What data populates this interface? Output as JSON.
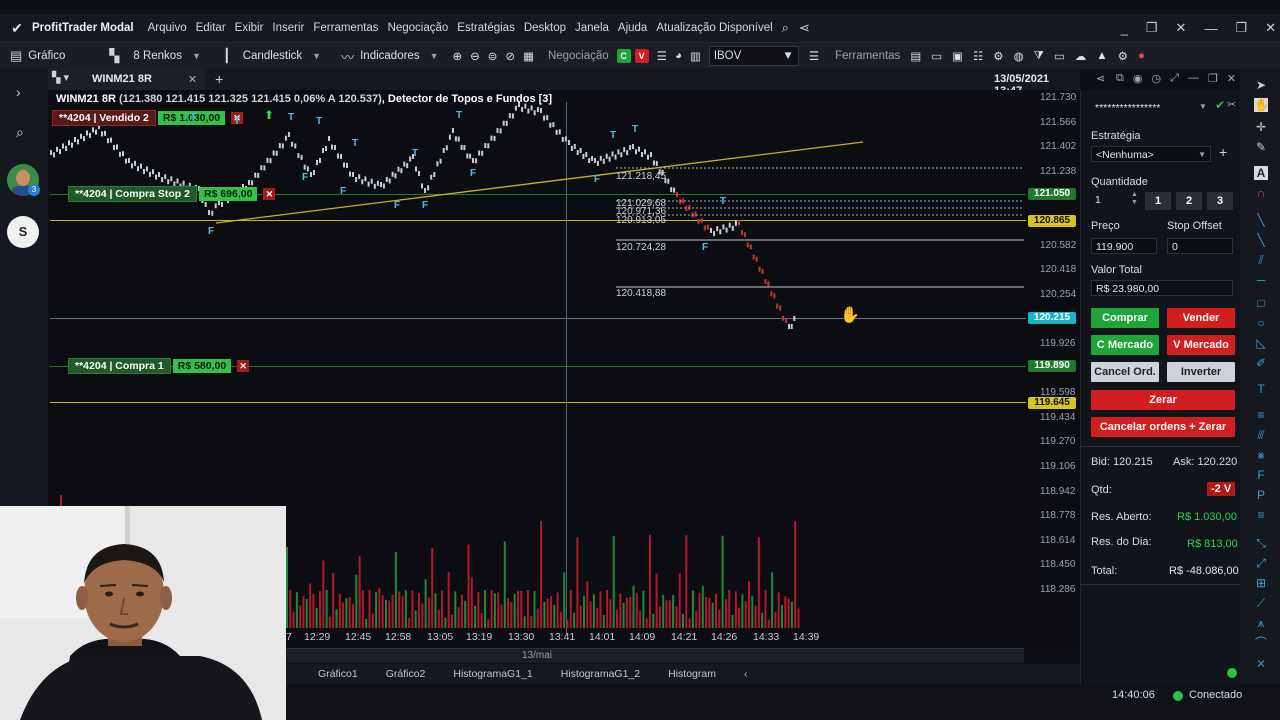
{
  "app": {
    "title": "ProfitTrader Modal",
    "menu": [
      "Arquivo",
      "Editar",
      "Exibir",
      "Inserir",
      "Ferramentas",
      "Negociação",
      "Estratégias",
      "Desktop",
      "Janela",
      "Ajuda",
      "Atualização Disponível"
    ]
  },
  "toolbar": {
    "grafico": "Gráfico",
    "renkos": "8 Renkos",
    "candlestick": "Candlestick",
    "indicadores": "Indicadores",
    "negociacao": "Negociação",
    "c_label": "C",
    "v_label": "V",
    "symbol": "IBOV",
    "ferramentas": "Ferramentas"
  },
  "chart_tab": {
    "name": "WINM21 8R",
    "datetime": "13/05/2021 13:47"
  },
  "chart": {
    "header_symbol": "WINM21 8R",
    "header_values": "(121.380  121.415  121.325  121.415  0,06%  A 120.537)",
    "header_indicator": ", Detector de Topos e Fundos [3]",
    "orders": [
      {
        "name": "**4204 | Vendido 2",
        "value": "R$ 1.030,00"
      },
      {
        "name": "**4204 | Compra Stop 2",
        "value": "R$ 696,00"
      },
      {
        "name": "**4204 | Compra 1",
        "value": "R$ 580,00"
      }
    ],
    "fibo_levels": [
      "121.218,45",
      "121.029,68",
      "120.971,36",
      "120.913,05",
      "120.724,28",
      "120.418,88"
    ],
    "price_tags": [
      {
        "label": "121.050",
        "color": "#1f7a2e"
      },
      {
        "label": "120.865",
        "color": "#d8c41a"
      },
      {
        "label": "120.215",
        "color": "#17b5c8"
      },
      {
        "label": "119.890",
        "color": "#1f7a2e"
      },
      {
        "label": "119.645",
        "color": "#d8c41a"
      }
    ],
    "y_axis": [
      "121.730",
      "121.566",
      "121.402",
      "121.238",
      "120.910",
      "120.746",
      "120.582",
      "120.418",
      "120.254",
      "120.090",
      "119.926",
      "119.762",
      "119.598",
      "119.434",
      "119.270",
      "119.106",
      "118.942",
      "118.778",
      "118.614",
      "118.450",
      "118.286"
    ],
    "x_axis": [
      "12:29",
      "12:45",
      "12:58",
      "13:05",
      "13:19",
      "13:30",
      "13:41",
      "14:01",
      "14:09",
      "14:21",
      "14:26",
      "14:33",
      "14:39"
    ],
    "x_partial": "7",
    "date_label": "13/mai",
    "markers": {
      "top": "T",
      "bottom": "F"
    }
  },
  "bottom_tabs": [
    "Gráfico1",
    "Gráfico2",
    "HistogramaG1_1",
    "HistogramaG1_2",
    "Histogram"
  ],
  "panel": {
    "account_masked": "****************",
    "strategy_label": "Estratégia",
    "strategy_value": "<Nenhuma>",
    "qty_label": "Quantidade",
    "qty_value": "1",
    "qty_presets": [
      "1",
      "2",
      "3"
    ],
    "price_label": "Preço",
    "price_value": "119.900",
    "stop_label": "Stop Offset",
    "stop_value": "0",
    "total_label": "Valor Total",
    "total_value": "R$ 23.980,00",
    "buttons": {
      "comprar": "Comprar",
      "vender": "Vender",
      "c_mercado": "C Mercado",
      "v_mercado": "V Mercado",
      "cancel_ord": "Cancel Ord.",
      "inverter": "Inverter",
      "zerar": "Zerar",
      "cancelar_zerar": "Cancelar ordens + Zerar"
    },
    "bid": "Bid: 120.215",
    "ask": "Ask: 120.220",
    "qtd_label": "Qtd:",
    "qtd_value": "-2 V",
    "res_aberto_label": "Res. Aberto:",
    "res_aberto_value": "R$ 1.030,00",
    "res_dia_label": "Res. do Dia:",
    "res_dia_value": "R$ 813,00",
    "total_res_label": "Total:",
    "total_res_value": "R$ -48.086,00"
  },
  "status": {
    "time": "14:40:06",
    "connection": "Conectado"
  },
  "left_rail": {
    "avatar_badge": "3",
    "s_label": "S"
  },
  "colors": {
    "green": "#1fa53a",
    "red": "#d21e1e",
    "yellow": "#d8c41a",
    "teal": "#17b5c8"
  }
}
